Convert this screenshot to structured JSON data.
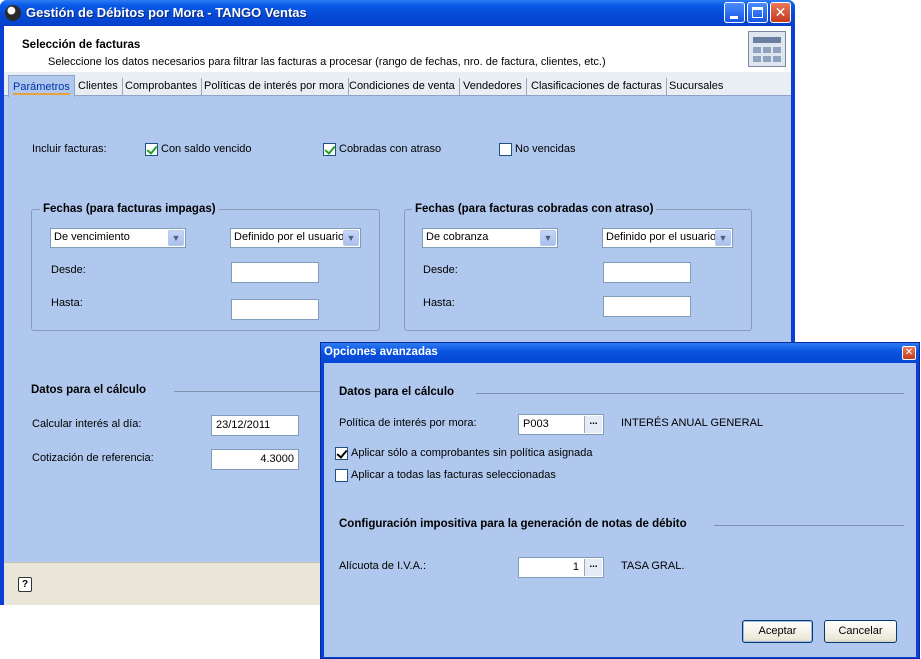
{
  "main_window": {
    "title": "Gestión de Débitos por Mora - TANGO Ventas",
    "header": {
      "title": "Selección de facturas",
      "subtitle": "Seleccione los datos necesarios para filtrar las facturas a procesar (rango de fechas, nro. de factura, clientes, etc.)"
    },
    "tabs": [
      {
        "label": "Parámetros",
        "active": true
      },
      {
        "label": "Clientes"
      },
      {
        "label": "Comprobantes"
      },
      {
        "label": "Políticas de interés por mora"
      },
      {
        "label": "Condiciones de venta"
      },
      {
        "label": "Vendedores"
      },
      {
        "label": "Clasificaciones de facturas"
      },
      {
        "label": "Sucursales"
      }
    ],
    "incluir": {
      "label": "Incluir facturas:",
      "options": [
        {
          "label": "Con saldo vencido",
          "checked": true
        },
        {
          "label": "Cobradas con atraso",
          "checked": true
        },
        {
          "label": "No vencidas",
          "checked": false
        }
      ]
    },
    "fechas_impagas": {
      "title": "Fechas (para facturas impagas)",
      "type_select": "De vencimiento",
      "range_select": "Definido por el usuario",
      "desde_label": "Desde:",
      "hasta_label": "Hasta:",
      "desde_value": "",
      "hasta_value": ""
    },
    "fechas_cobradas": {
      "title": "Fechas (para facturas cobradas con atraso)",
      "type_select": "De cobranza",
      "range_select": "Definido por el usuario",
      "desde_label": "Desde:",
      "hasta_label": "Hasta:",
      "desde_value": "",
      "hasta_value": ""
    },
    "calculo": {
      "title": "Datos para el cálculo",
      "interes_label": "Calcular interés al día:",
      "interes_value": "23/12/2011",
      "cotizacion_label": "Cotización de referencia:",
      "cotizacion_value": "4.3000"
    },
    "help_glyph": "?"
  },
  "dialog": {
    "title": "Opciones avanzadas",
    "calculo_title": "Datos para el cálculo",
    "politica_label": "Política de interés por mora:",
    "politica_value": "P003",
    "politica_desc": "INTERÉS ANUAL GENERAL",
    "check1": {
      "label": "Aplicar sólo a comprobantes sin política asignada",
      "checked": true
    },
    "check2": {
      "label": "Aplicar a todas las facturas seleccionadas",
      "checked": false
    },
    "config_title": "Configuración impositiva para la generación de notas de débito",
    "alicuota_label": "Alícuota de I.V.A.:",
    "alicuota_value": "1",
    "alicuota_desc": "TASA GRAL.",
    "ellipsis": "...",
    "accept_label": "Aceptar",
    "cancel_label": "Cancelar"
  }
}
